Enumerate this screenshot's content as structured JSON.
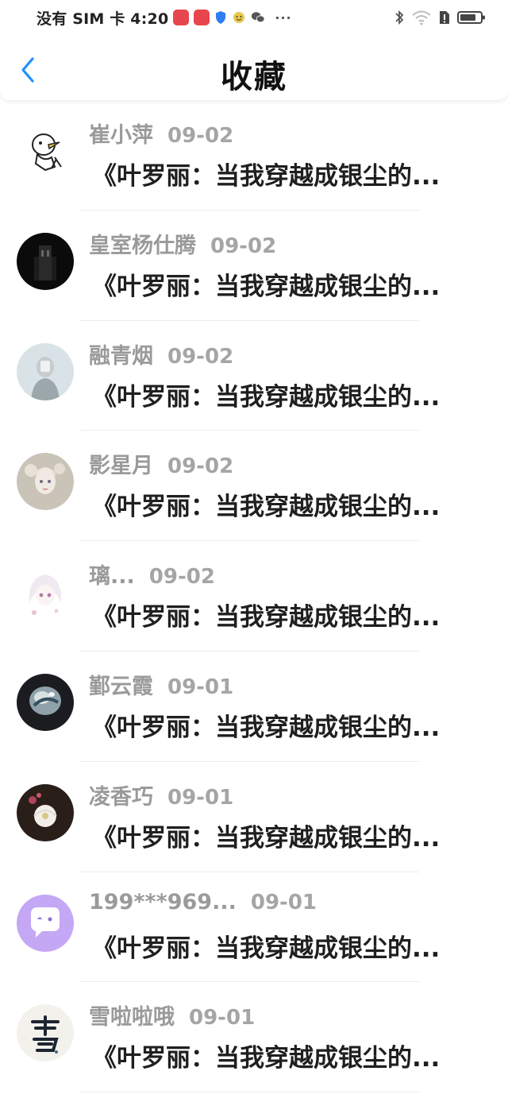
{
  "status_bar": {
    "carrier_time": "没有 SIM 卡 4:20",
    "more": "···"
  },
  "header": {
    "title": "收藏"
  },
  "items": [
    {
      "name": "崔小萍",
      "date": "09-02",
      "text": "《叶罗丽：当我穿越成银尘的..."
    },
    {
      "name": "皇室杨仕腾",
      "date": "09-02",
      "text": "《叶罗丽：当我穿越成银尘的..."
    },
    {
      "name": "融青烟",
      "date": "09-02",
      "text": "《叶罗丽：当我穿越成银尘的..."
    },
    {
      "name": "影星月",
      "date": "09-02",
      "text": "《叶罗丽：当我穿越成银尘的..."
    },
    {
      "name": "璃...",
      "date": "09-02",
      "text": "《叶罗丽：当我穿越成银尘的..."
    },
    {
      "name": "鄞云霞",
      "date": "09-01",
      "text": "《叶罗丽：当我穿越成银尘的..."
    },
    {
      "name": "凌香巧",
      "date": "09-01",
      "text": "《叶罗丽：当我穿越成银尘的..."
    },
    {
      "name": "199***969...",
      "date": "09-01",
      "text": "《叶罗丽：当我穿越成银尘的..."
    },
    {
      "name": "雪啦啦哦",
      "date": "09-01",
      "text": "《叶罗丽：当我穿越成银尘的..."
    }
  ],
  "colors": {
    "accent_blue": "#1e90ff",
    "text_dark": "#1f1f1f",
    "text_gray": "#9b9b9b"
  }
}
